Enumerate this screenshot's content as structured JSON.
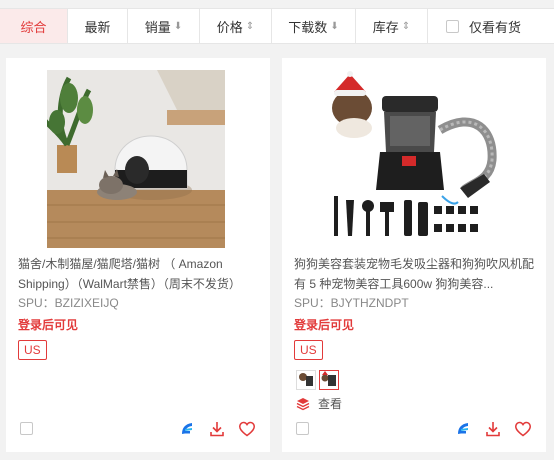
{
  "sort_bar": {
    "items": [
      {
        "label": "综合",
        "arrow": ""
      },
      {
        "label": "最新",
        "arrow": ""
      },
      {
        "label": "销量",
        "arrow": "⬇"
      },
      {
        "label": "价格",
        "arrow": "⇕"
      },
      {
        "label": "下载数",
        "arrow": "⬇"
      },
      {
        "label": "库存",
        "arrow": "⇕"
      }
    ],
    "active_index": 0,
    "stock_filter_label": "仅看有货"
  },
  "products": [
    {
      "image_icon": "cat-litter-box-photo",
      "title": "猫舍/木制猫屋/猫爬塔/猫树 （ Amazon Shipping）（WalMart禁售）（周末不发货）",
      "spu": "SPU：BZIZIXEIJQ",
      "price_note": "登录后可见",
      "tag": "US"
    },
    {
      "image_icon": "pet-grooming-vacuum-photo",
      "title": "狗狗美容套装宠物毛发吸尘器和狗狗吹风机配有 5 种宠物美容工具600w 狗狗美容...",
      "spu": "SPU：BJYTHZNDPT",
      "price_note": "登录后可见",
      "tag": "US",
      "view_more_label": "查看"
    }
  ],
  "colors": {
    "accent": "#e23a3a",
    "active_bg": "#fbeaea",
    "brand_blue": "#1a73e8"
  }
}
